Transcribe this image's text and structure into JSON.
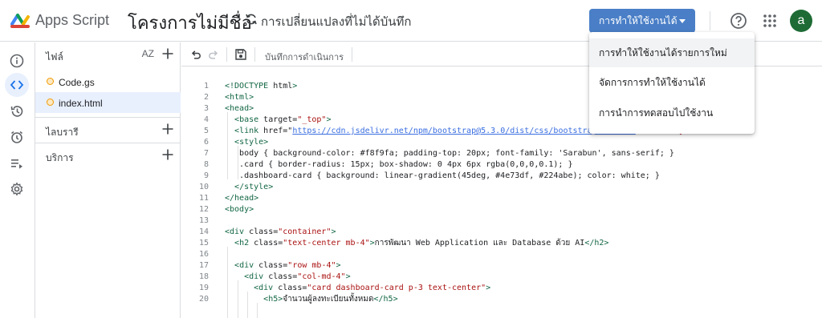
{
  "header": {
    "brand": "Apps Script",
    "project_title": "โครงการไม่มีชื่อ",
    "save_status": "การเปลี่ยนแปลงที่ไม่ได้บันทึก",
    "deploy_label": "การทำให้ใช้งานได้",
    "avatar_letter": "a",
    "accent_color": "#4a7fc7"
  },
  "rail": {
    "items": [
      {
        "icon": "info-icon"
      },
      {
        "icon": "code-icon"
      },
      {
        "icon": "history-icon"
      },
      {
        "icon": "alarm-icon"
      },
      {
        "icon": "executions-icon"
      },
      {
        "icon": "gear-icon"
      }
    ]
  },
  "sidebar": {
    "files_header": "ไฟล์",
    "sort_label": "AZ",
    "files": [
      {
        "name": "Code.gs"
      },
      {
        "name": "index.html"
      }
    ],
    "libraries_header": "ไลบรารี",
    "services_header": "บริการ"
  },
  "toolbar": {
    "log_label": "บันทึกการดำเนินการ"
  },
  "dropdown": {
    "items": [
      "การทำให้ใช้งานได้รายการใหม่",
      "จัดการการทำให้ใช้งานได้",
      "การนำการทดสอบไปใช้งาน"
    ]
  },
  "code": {
    "lines": [
      {
        "n": "1",
        "t": "<!DOCTYPE html>"
      },
      {
        "n": "2",
        "t": "<html>"
      },
      {
        "n": "3",
        "t": "<head>"
      },
      {
        "n": "4",
        "t": "  <base target=\"_top\">"
      },
      {
        "n": "5",
        "t": "  <link href=\"https://cdn.jsdelivr.net/npm/bootstrap@5.3.0/dist/css/bootstrap.min.css\" rel=\"stylesheet\">"
      },
      {
        "n": "6",
        "t": "  <style>"
      },
      {
        "n": "7",
        "t": "   body { background-color: #f8f9fa; padding-top: 20px; font-family: 'Sarabun', sans-serif; }"
      },
      {
        "n": "8",
        "t": "   .card { border-radius: 15px; box-shadow: 0 4px 6px rgba(0,0,0,0.1); }"
      },
      {
        "n": "9",
        "t": "   .dashboard-card { background: linear-gradient(45deg, #4e73df, #224abe); color: white; }"
      },
      {
        "n": "10",
        "t": "  </style>"
      },
      {
        "n": "11",
        "t": "</head>"
      },
      {
        "n": "12",
        "t": "<body>"
      },
      {
        "n": "13",
        "t": ""
      },
      {
        "n": "14",
        "t": "<div class=\"container\">"
      },
      {
        "n": "15",
        "t": "  <h2 class=\"text-center mb-4\">การพัฒนา Web Application และ Database ด้วย AI</h2>"
      },
      {
        "n": "16",
        "t": ""
      },
      {
        "n": "17",
        "t": "  <div class=\"row mb-4\">"
      },
      {
        "n": "18",
        "t": "    <div class=\"col-md-4\">"
      },
      {
        "n": "19",
        "t": "      <div class=\"card dashboard-card p-3 text-center\">"
      },
      {
        "n": "20",
        "t": "        <h5>จำนวนผู้ลงทะเบียนทั้งหมด</h5>"
      }
    ]
  }
}
